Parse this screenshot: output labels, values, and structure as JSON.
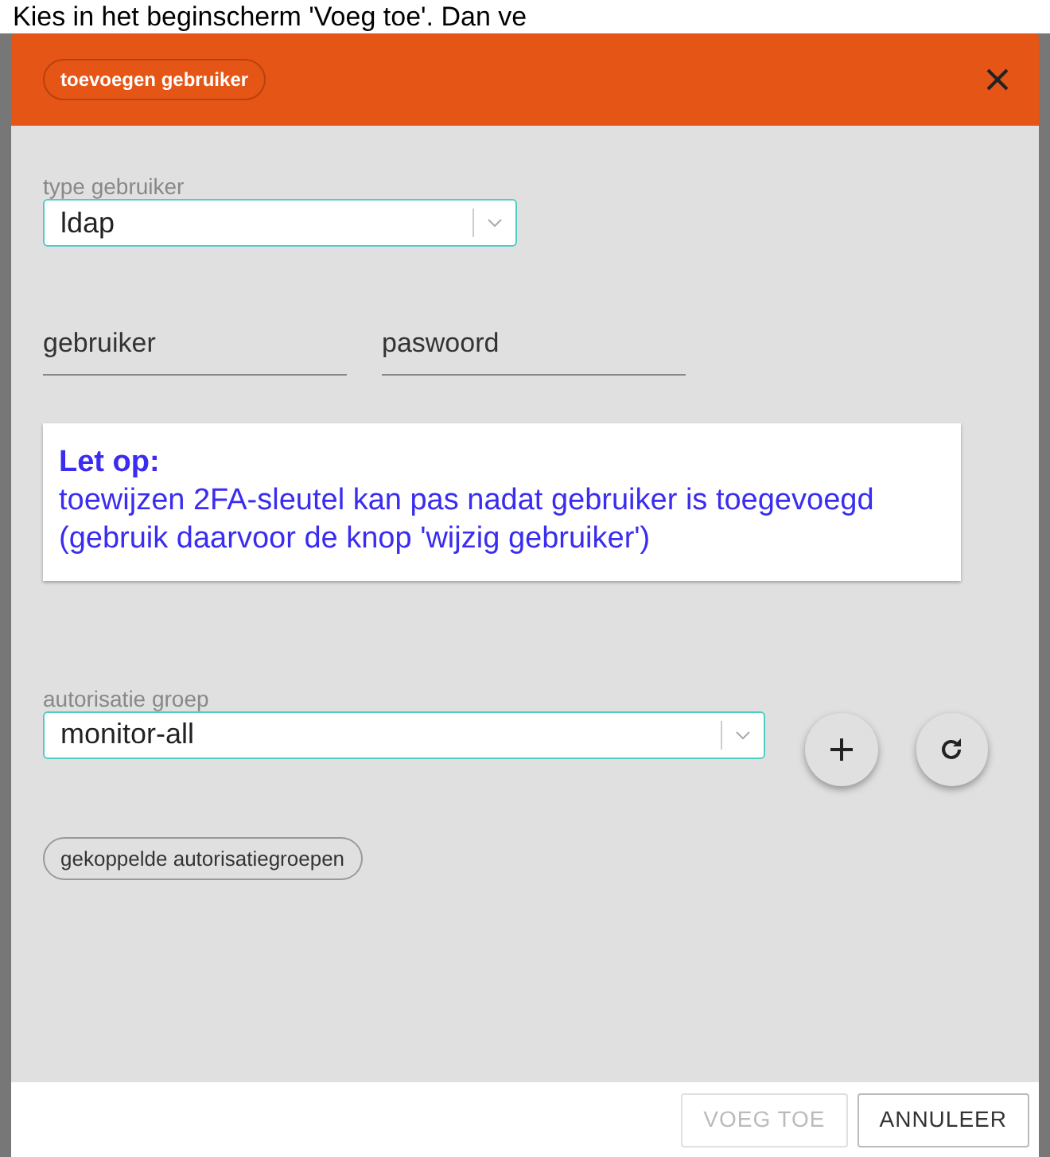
{
  "background_text": "Kies in het beginscherm 'Voeg toe'. Dan ve",
  "dialog": {
    "title": "toevoegen gebruiker",
    "user_type": {
      "label": "type gebruiker",
      "value": "ldap"
    },
    "fields": [
      {
        "placeholder": "gebruiker"
      },
      {
        "placeholder": "paswoord"
      }
    ],
    "notice": {
      "title": "Let op:",
      "text": "toewijzen 2FA-sleutel kan pas nadat gebruiker is toegevoegd (gebruik daarvoor de knop 'wijzig gebruiker')"
    },
    "auth_group": {
      "label": "autorisatie groep",
      "value": "monitor-all"
    },
    "linked_groups_chip": "gekoppelde autorisatiegroepen",
    "buttons": [
      {
        "label": "VOEG TOE",
        "disabled": true
      },
      {
        "label": "ANNULEER",
        "disabled": false
      }
    ]
  }
}
